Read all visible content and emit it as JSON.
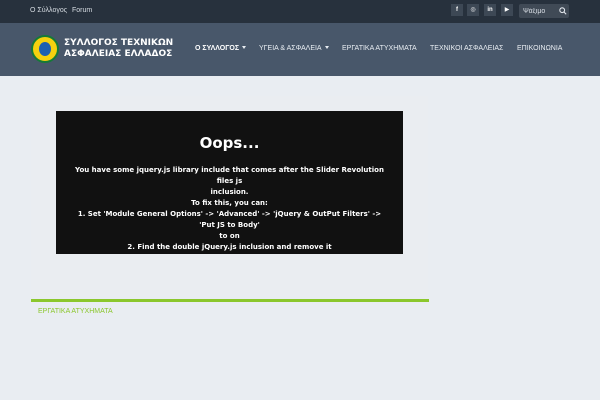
{
  "topbar": {
    "links": [
      "Ο Σύλλογος",
      "Forum"
    ],
    "social": [
      {
        "icon": "facebook-icon",
        "glyph": "f"
      },
      {
        "icon": "instagram-icon",
        "glyph": "◎"
      },
      {
        "icon": "linkedin-icon",
        "glyph": "in"
      },
      {
        "icon": "youtube-icon",
        "glyph": "▶"
      }
    ],
    "search": {
      "placeholder": "Ψάξιμο",
      "icon": "search-icon"
    }
  },
  "logo": {
    "line1": "ΣΥΛΛΟΓΟΣ ΤΕΧΝΙΚΩΝ",
    "line2": "ΑΣΦΑΛΕΙΑΣ ΕΛΛΑΔΟΣ",
    "colors": {
      "ring": "#157a37",
      "fill": "#f5d10f",
      "center": "#1c60b1"
    }
  },
  "nav": {
    "items": [
      {
        "label": "Ο ΣΥΛΛΟΓΟΣ",
        "dropdown": true,
        "active": true
      },
      {
        "label": "ΥΓΕΙΑ & ΑΣΦΑΛΕΙΑ",
        "dropdown": true,
        "active": false
      },
      {
        "label": "ΕΡΓΑΤΙΚΑ ΑΤΥΧΗΜΑΤΑ",
        "dropdown": false,
        "active": false
      },
      {
        "label": "ΤΕΧΝΙΚΟΙ ΑΣΦΑΛΕΙΑΣ",
        "dropdown": false,
        "active": false
      },
      {
        "label": "ΕΠΙΚΟΙΝΩΝΙΑ",
        "dropdown": false,
        "active": false
      }
    ]
  },
  "slider_error": {
    "title": "Oops...",
    "lines": [
      "You have some jquery.js library include that comes after the Slider Revolution files js",
      "inclusion.",
      "To fix this, you can:",
      "1. Set 'Module General Options' -> 'Advanced' -> 'jQuery & OutPut Filters' -> 'Put JS to Body'",
      "to on",
      "2. Find the double jQuery.js inclusion and remove it"
    ]
  },
  "section": {
    "title": "ΕΡΓΑΤΙΚΑ ΑΤΥΧΗΜΑΤΑ"
  },
  "colors": {
    "topbar_bg": "#27313d",
    "header_bg": "#48576a",
    "page_bg": "#e9edf2",
    "accent_green": "#8bc72d",
    "error_bg": "#111111"
  }
}
